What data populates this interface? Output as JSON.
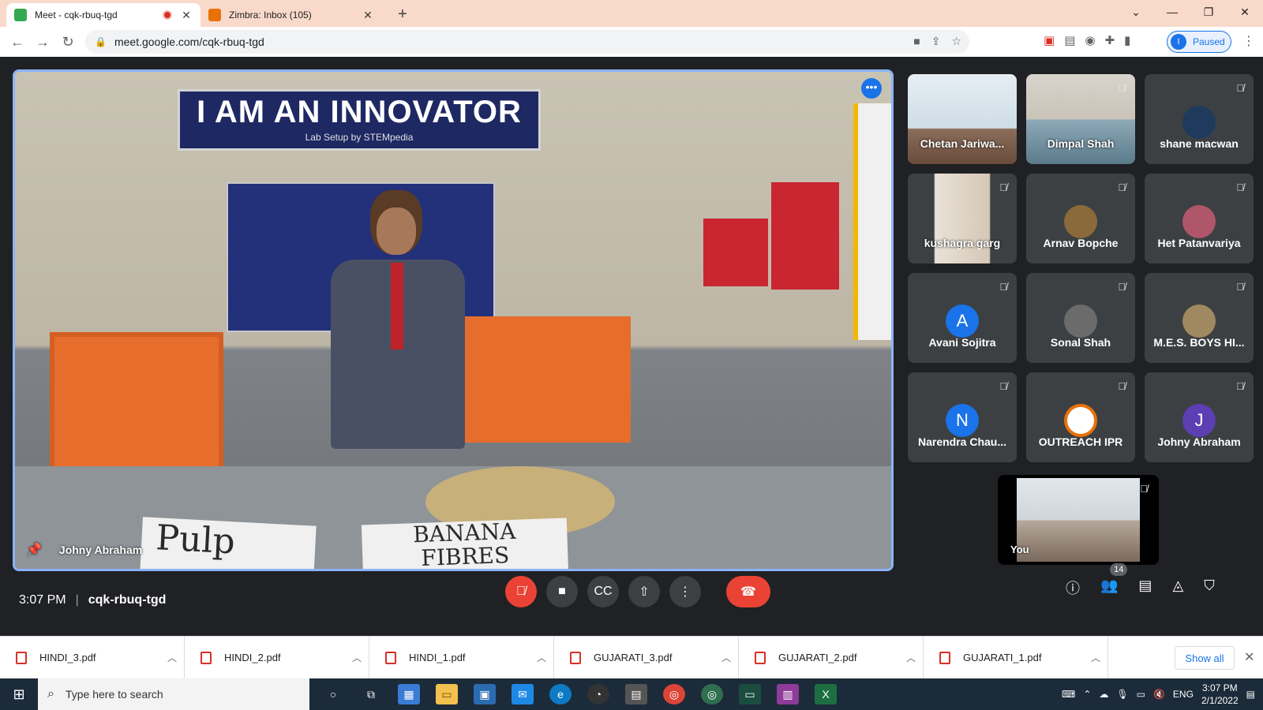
{
  "browser": {
    "tabs": [
      {
        "title": "Meet - cqk-rbuq-tgd",
        "favicon_color": "#34a853",
        "active": true,
        "recording": true
      },
      {
        "title": "Zimbra: Inbox (105)",
        "favicon_color": "#e8710a",
        "active": false
      }
    ],
    "url": "meet.google.com/cqk-rbuq-tgd",
    "profile_initial": "I",
    "profile_status": "Paused"
  },
  "meet": {
    "main_speaker": "Johny Abraham",
    "scene": {
      "banner_title": "I AM AN INNOVATOR",
      "banner_sub": "Lab Setup by STEMpedia",
      "card_left": "Pulp",
      "card_right_line1": "BANANA",
      "card_right_line2": "FIBRES"
    },
    "participants": [
      {
        "name": "Chetan Jariwa...",
        "type": "video",
        "muted": false
      },
      {
        "name": "Dimpal Shah",
        "type": "video",
        "muted": true
      },
      {
        "name": "shane macwan",
        "type": "photo",
        "muted": true,
        "color": "#1e3a5c"
      },
      {
        "name": "kushagra garg",
        "type": "video",
        "muted": true
      },
      {
        "name": "Arnav Bopche",
        "type": "photo",
        "muted": true,
        "color": "#8a6a3a"
      },
      {
        "name": "Het Patanvariya",
        "type": "photo",
        "muted": true,
        "color": "#b0566a"
      },
      {
        "name": "Avani Sojitra",
        "type": "initial",
        "initial": "A",
        "color": "#1a73e8",
        "muted": true
      },
      {
        "name": "Sonal Shah",
        "type": "photo",
        "muted": true,
        "color": "#6b6b6b"
      },
      {
        "name": "M.E.S. BOYS HI...",
        "type": "photo",
        "muted": true,
        "color": "#a08860"
      },
      {
        "name": "Narendra Chau...",
        "type": "initial",
        "initial": "N",
        "color": "#1a73e8",
        "muted": true
      },
      {
        "name": "OUTREACH IPR",
        "type": "photo",
        "muted": true,
        "color": "#e8710a"
      },
      {
        "name": "Johny Abraham",
        "type": "initial",
        "initial": "J",
        "color": "#5b3fb3",
        "muted": true
      }
    ],
    "self_label": "You",
    "time": "3:07 PM",
    "meeting_code": "cqk-rbuq-tgd",
    "people_count": "14"
  },
  "downloads": {
    "files": [
      "HINDI_3.pdf",
      "HINDI_2.pdf",
      "HINDI_1.pdf",
      "GUJARATI_3.pdf",
      "GUJARATI_2.pdf",
      "GUJARATI_1.pdf"
    ],
    "show_all": "Show all"
  },
  "taskbar": {
    "search_placeholder": "Type here to search",
    "lang": "ENG",
    "time": "3:07 PM",
    "date": "2/1/2022"
  }
}
